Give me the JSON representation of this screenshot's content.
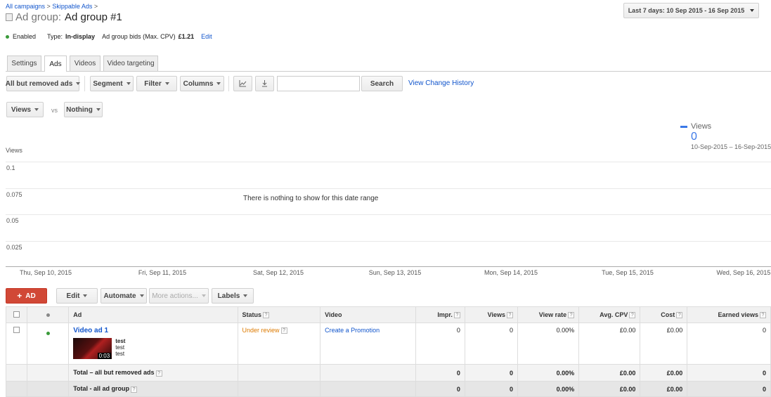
{
  "breadcrumb": {
    "part1": "All campaigns",
    "sep1": ">",
    "part2": "Skippable Ads",
    "sep2": ">"
  },
  "header": {
    "prefix": "Ad group:",
    "name": "Ad group #1"
  },
  "daterange": {
    "label": "Last 7 days: 10 Sep 2015 - 16 Sep 2015"
  },
  "status_line": {
    "status": "Enabled",
    "type_label": "Type:",
    "type_value": "In-display",
    "bids_label": "Ad group bids (Max. CPV)",
    "bids_value": "£1.21",
    "edit": "Edit"
  },
  "tabs": [
    "Settings",
    "Ads",
    "Videos",
    "Video targeting"
  ],
  "toolbar": {
    "filter_all": "All but removed ads",
    "segment": "Segment",
    "filter": "Filter",
    "columns": "Columns",
    "search_placeholder": "",
    "search": "Search",
    "change_history": "View Change History"
  },
  "metrics": {
    "metric1": "Views",
    "vs": "vs",
    "metric2": "Nothing"
  },
  "chart_data": {
    "type": "line",
    "ylabel": "Views",
    "yticks": [
      "0.1",
      "0.075",
      "0.05",
      "0.025"
    ],
    "categories": [
      "Thu, Sep 10, 2015",
      "Fri, Sep 11, 2015",
      "Sat, Sep 12, 2015",
      "Sun, Sep 13, 2015",
      "Mon, Sep 14, 2015",
      "Tue, Sep 15, 2015",
      "Wed, Sep 16, 2015"
    ],
    "series": [
      {
        "name": "Views",
        "values": [],
        "total": "0",
        "range": "10-Sep-2015 – 16-Sep-2015",
        "color": "#3b78e7"
      }
    ],
    "empty_message": "There is nothing to show for this date range"
  },
  "actions": {
    "add": "AD",
    "edit": "Edit",
    "automate": "Automate",
    "more": "More actions...",
    "labels": "Labels"
  },
  "table": {
    "headers": {
      "ad": "Ad",
      "status": "Status",
      "video": "Video",
      "impr": "Impr.",
      "views": "Views",
      "view_rate": "View rate",
      "avg_cpv": "Avg. CPV",
      "cost": "Cost",
      "earned_views": "Earned views"
    },
    "rows": [
      {
        "ad": "Video ad 1",
        "line1": "test",
        "line2": "test",
        "line3": "test",
        "duration": "0:03",
        "status": "Under review",
        "video": "Create a Promotion",
        "impr": "0",
        "views": "0",
        "view_rate": "0.00%",
        "avg_cpv": "£0.00",
        "cost": "£0.00",
        "earned_views": "0"
      }
    ],
    "totals": [
      {
        "label": "Total – all but removed ads",
        "impr": "0",
        "views": "0",
        "view_rate": "0.00%",
        "avg_cpv": "£0.00",
        "cost": "£0.00",
        "earned_views": "0"
      },
      {
        "label": "Total - all ad group",
        "impr": "0",
        "views": "0",
        "view_rate": "0.00%",
        "avg_cpv": "£0.00",
        "cost": "£0.00",
        "earned_views": "0"
      }
    ]
  }
}
